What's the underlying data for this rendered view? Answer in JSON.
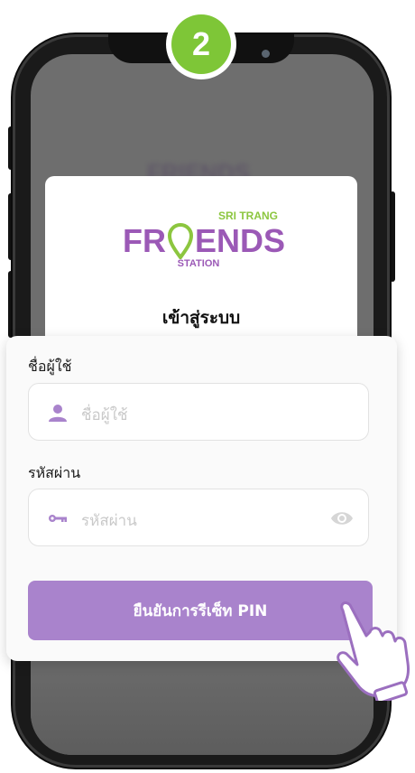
{
  "step_badge": "2",
  "logo": {
    "top": "SRI TRANG",
    "main_left": "FR",
    "main_right": "ENDS",
    "sub": "STATION"
  },
  "blurred_logo": "FRIENDS",
  "login_title": "เข้าสู่ระบบ",
  "form": {
    "username_label": "ชื่อผู้ใช้",
    "username_placeholder": "ชื่อผู้ใช้",
    "password_label": "รหัสผ่าน",
    "password_placeholder": "รหัสผ่าน",
    "submit_label": "ยืนยันการรีเซ็ท PIN"
  },
  "icons": {
    "user": "user-icon",
    "key": "key-icon",
    "eye": "eye-icon",
    "hand": "pointing-hand-icon"
  },
  "colors": {
    "accent": "#a983cc",
    "brand_purple": "#9b59b6",
    "brand_green": "#8cc63f",
    "badge_green": "#7ec637"
  }
}
